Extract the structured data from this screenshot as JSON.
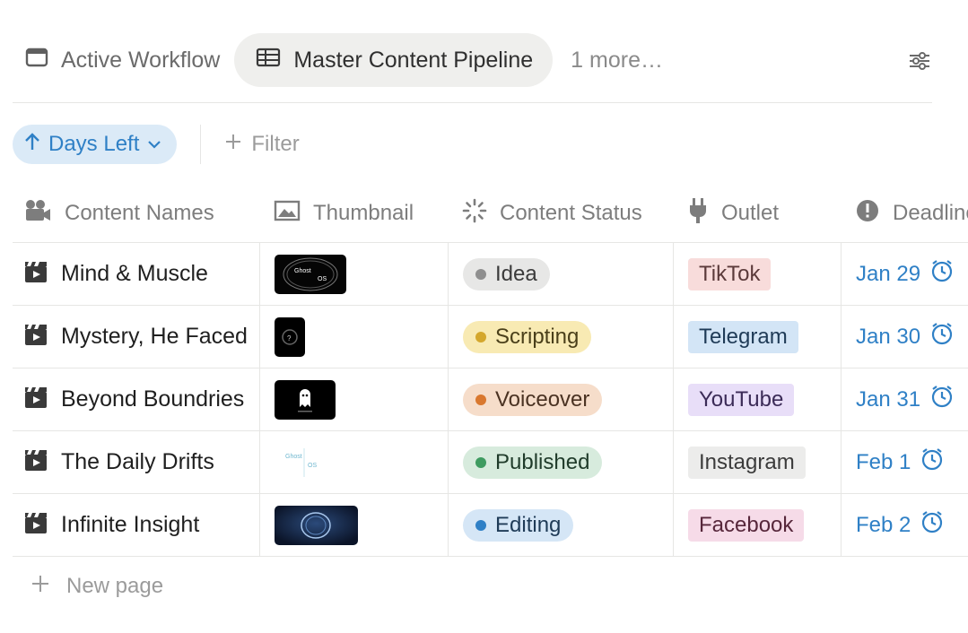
{
  "tabs": [
    {
      "label": "Active Workflow",
      "icon": "browser-window-icon",
      "active": false
    },
    {
      "label": "Master Content Pipeline",
      "icon": "table-icon",
      "active": true
    }
  ],
  "tabs_more": "1 more…",
  "filters": {
    "sort_label": "Days Left",
    "filter_label": "Filter"
  },
  "columns": [
    {
      "label": "Content Names",
      "icon": "film-camera-icon"
    },
    {
      "label": "Thumbnail",
      "icon": "image-icon"
    },
    {
      "label": "Content Status",
      "icon": "loading-spinner-icon"
    },
    {
      "label": "Outlet",
      "icon": "plug-icon"
    },
    {
      "label": "Deadline",
      "icon": "alert-circle-icon"
    }
  ],
  "rows": [
    {
      "name": "Mind & Muscle",
      "thumbnail": {
        "style": "dark-circle",
        "text_a": "Ghost",
        "text_b": "OS"
      },
      "status": {
        "label": "Idea",
        "bg": "#e7e7e6",
        "dot": "#8f8f8f",
        "color": "#3b3b3b"
      },
      "outlet": {
        "label": "TikTok",
        "bg": "#f8dcdb",
        "color": "#5b3a3a"
      },
      "deadline": "Jan 29"
    },
    {
      "name": "Mystery, He Faced",
      "thumbnail": {
        "style": "portrait-dark",
        "text_a": "?",
        "text_b": ""
      },
      "status": {
        "label": "Scripting",
        "bg": "#f8eab3",
        "dot": "#d4a72c",
        "color": "#4a3f1a"
      },
      "outlet": {
        "label": "Telegram",
        "bg": "#d3e5f6",
        "color": "#1f3b57"
      },
      "deadline": "Jan 30"
    },
    {
      "name": "Beyond Boundries",
      "thumbnail": {
        "style": "ghost-dark",
        "text_a": "",
        "text_b": ""
      },
      "status": {
        "label": "Voiceover",
        "bg": "#f6ddca",
        "dot": "#d9782f",
        "color": "#4a3222"
      },
      "outlet": {
        "label": "YouTube",
        "bg": "#e8def8",
        "color": "#3b2b57"
      },
      "deadline": "Jan 31"
    },
    {
      "name": "The Daily Drifts",
      "thumbnail": {
        "style": "light-logo",
        "text_a": "Ghost",
        "text_b": "OS"
      },
      "status": {
        "label": "Published",
        "bg": "#d7ebdd",
        "dot": "#3e9b60",
        "color": "#1f3b2a"
      },
      "outlet": {
        "label": "Instagram",
        "bg": "#ececeb",
        "color": "#3b3b3b"
      },
      "deadline": "Feb 1"
    },
    {
      "name": "Infinite Insight",
      "thumbnail": {
        "style": "blue-ring",
        "text_a": "",
        "text_b": ""
      },
      "status": {
        "label": "Editing",
        "bg": "#d5e6f6",
        "dot": "#2f80c6",
        "color": "#1f3b57"
      },
      "outlet": {
        "label": "Facebook",
        "bg": "#f6dbe8",
        "color": "#57273b"
      },
      "deadline": "Feb 2"
    }
  ],
  "new_page_label": "New page",
  "colors": {
    "accent_blue": "#2f80c6",
    "chip_blue_bg": "#dbeaf7",
    "border": "#e6e6e4",
    "muted_text": "#7d7d7d"
  }
}
